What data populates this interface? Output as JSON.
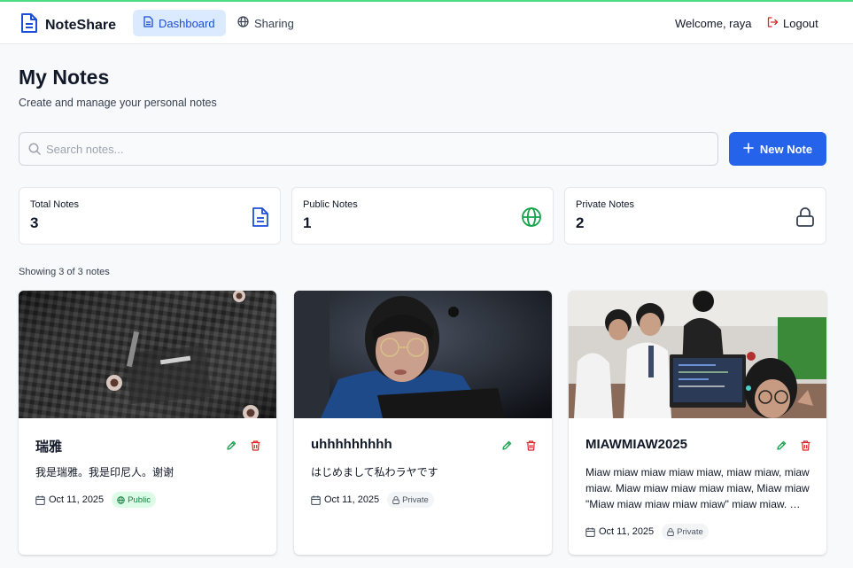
{
  "app": {
    "name": "NoteShare"
  },
  "nav": {
    "dashboard": "Dashboard",
    "sharing": "Sharing",
    "welcome": "Welcome, raya",
    "logout": "Logout"
  },
  "page": {
    "title": "My Notes",
    "subtitle": "Create and manage your personal notes"
  },
  "search": {
    "placeholder": "Search notes..."
  },
  "new_note_label": "New Note",
  "stats": [
    {
      "label": "Total Notes",
      "value": "3",
      "icon": "document-icon"
    },
    {
      "label": "Public Notes",
      "value": "1",
      "icon": "globe-icon"
    },
    {
      "label": "Private Notes",
      "value": "2",
      "icon": "lock-icon"
    }
  ],
  "showing": "Showing 3 of 3 notes",
  "notes": [
    {
      "title": "瑞雅",
      "body": "我是瑞雅。我是印尼人。谢谢",
      "date": "Oct 11, 2025",
      "visibility": "Public"
    },
    {
      "title": "uhhhhhhhhh",
      "body": "はじめまして私わラヤです",
      "date": "Oct 11, 2025",
      "visibility": "Private"
    },
    {
      "title": "MIAWMIAW2025",
      "body": "Miaw miaw miaw miaw miaw, miaw miaw, miaw miaw. Miaw miaw miaw miaw miaw, Miaw miaw \"Miaw miaw miaw miaw miaw\" miaw miaw. …",
      "date": "Oct 11, 2025",
      "visibility": "Private"
    }
  ],
  "colors": {
    "primary": "#2563eb",
    "public": "#16a34a",
    "danger": "#dc2626",
    "nav_active_bg": "#dbeafe"
  }
}
